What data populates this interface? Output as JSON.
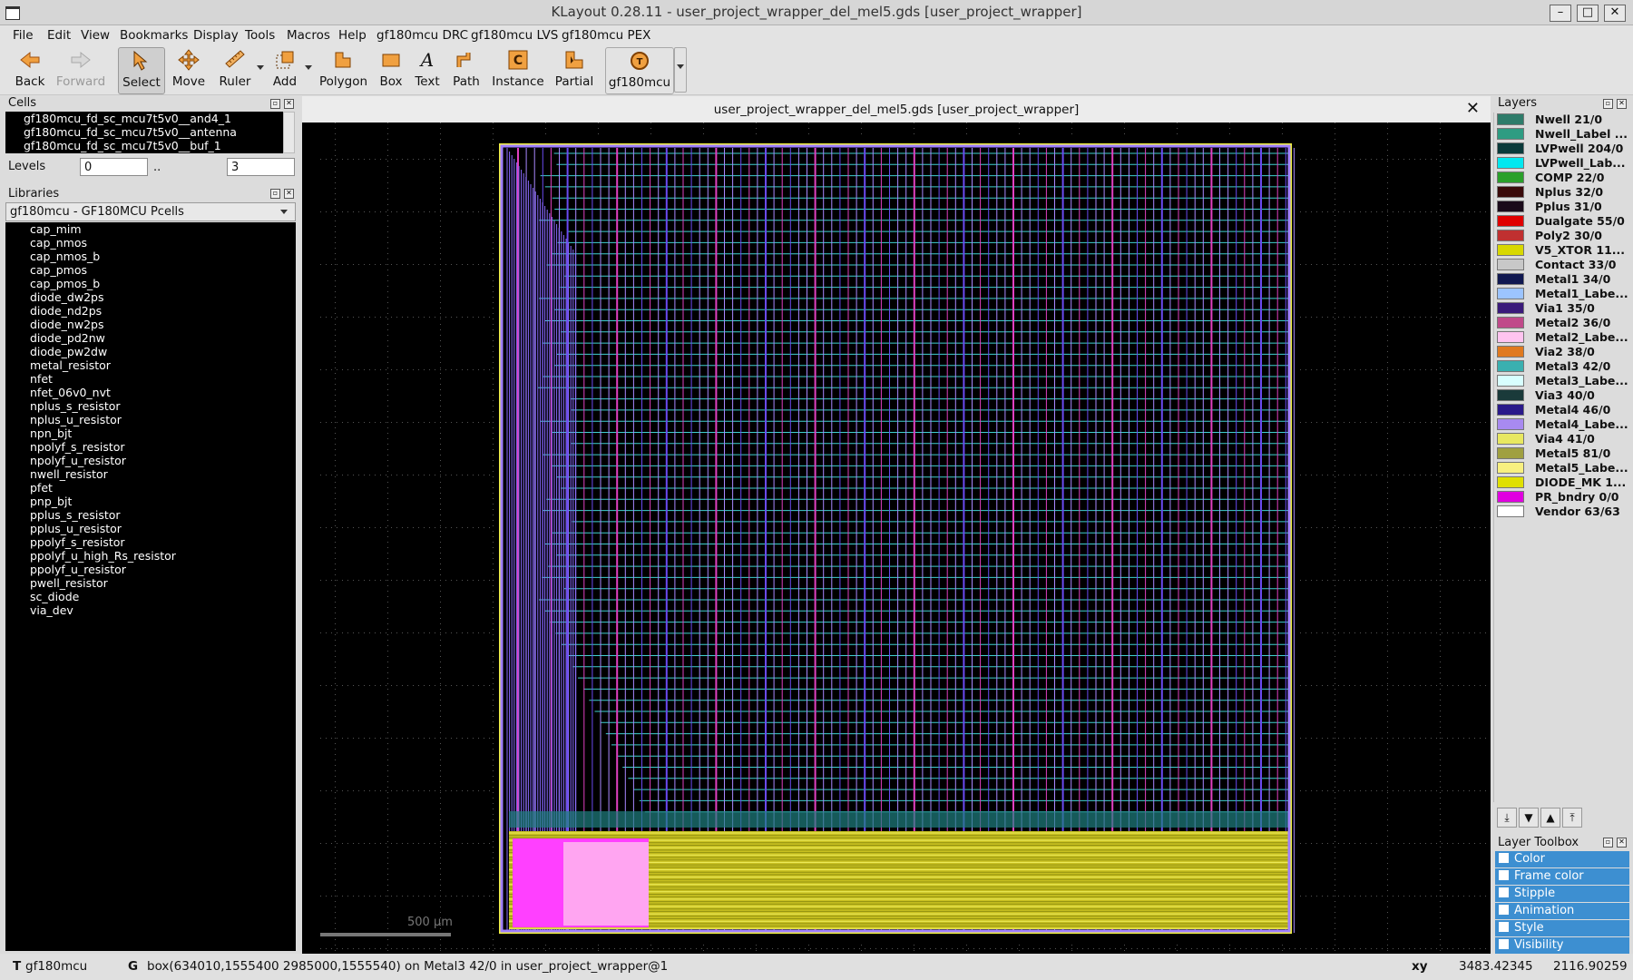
{
  "window": {
    "title": "KLayout 0.28.11 - user_project_wrapper_del_mel5.gds [user_project_wrapper]"
  },
  "menu": [
    "File",
    "Edit",
    "View",
    "Bookmarks",
    "Display",
    "Tools",
    "Macros",
    "Help",
    "gf180mcu DRC",
    "gf180mcu LVS",
    "gf180mcu PEX"
  ],
  "toolbar": {
    "back": "Back",
    "forward": "Forward",
    "select": "Select",
    "move": "Move",
    "ruler": "Ruler",
    "add": "Add",
    "polygon": "Polygon",
    "box": "Box",
    "text": "Text",
    "path": "Path",
    "instance": "Instance",
    "partial": "Partial",
    "tech": "gf180mcu"
  },
  "cells": {
    "title": "Cells",
    "items": [
      "gf180mcu_fd_sc_mcu7t5v0__and4_1",
      "gf180mcu_fd_sc_mcu7t5v0__antenna",
      "gf180mcu_fd_sc_mcu7t5v0__buf_1"
    ]
  },
  "levels": {
    "label": "Levels",
    "from": "0",
    "sep": "..",
    "to": "3"
  },
  "libraries": {
    "title": "Libraries",
    "selected": "gf180mcu - GF180MCU Pcells",
    "items": [
      "cap_mim",
      "cap_nmos",
      "cap_nmos_b",
      "cap_pmos",
      "cap_pmos_b",
      "diode_dw2ps",
      "diode_nd2ps",
      "diode_nw2ps",
      "diode_pd2nw",
      "diode_pw2dw",
      "metal_resistor",
      "nfet",
      "nfet_06v0_nvt",
      "nplus_s_resistor",
      "nplus_u_resistor",
      "npn_bjt",
      "npolyf_s_resistor",
      "npolyf_u_resistor",
      "nwell_resistor",
      "pfet",
      "pnp_bjt",
      "pplus_s_resistor",
      "pplus_u_resistor",
      "ppolyf_s_resistor",
      "ppolyf_u_high_Rs_resistor",
      "ppolyf_u_resistor",
      "pwell_resistor",
      "sc_diode",
      "via_dev"
    ]
  },
  "view": {
    "title": "user_project_wrapper_del_mel5.gds [user_project_wrapper]",
    "scale": "500 µm"
  },
  "layers": {
    "title": "Layers",
    "items": [
      {
        "name": "Nwell 21/0",
        "color": "#2e7c6a"
      },
      {
        "name": "Nwell_Label ...",
        "color": "#2e9c82"
      },
      {
        "name": "LVPwell 204/0",
        "color": "#0a3a3a"
      },
      {
        "name": "LVPwell_Lab...",
        "color": "#00e8f0"
      },
      {
        "name": "COMP 22/0",
        "color": "#2aa02a"
      },
      {
        "name": "Nplus 32/0",
        "color": "#3a0a0a"
      },
      {
        "name": "Pplus 31/0",
        "color": "#1a0a1a"
      },
      {
        "name": "Dualgate 55/0",
        "color": "#e00000"
      },
      {
        "name": "Poly2 30/0",
        "color": "#c03030"
      },
      {
        "name": "V5_XTOR 11...",
        "color": "#d8d800"
      },
      {
        "name": "Contact 33/0",
        "color": "#c8c8c8"
      },
      {
        "name": "Metal1 34/0",
        "color": "#101850"
      },
      {
        "name": "Metal1_Labe...",
        "color": "#9cc4ff"
      },
      {
        "name": "Via1 35/0",
        "color": "#3a1a7a"
      },
      {
        "name": "Metal2 36/0",
        "color": "#c04a8a"
      },
      {
        "name": "Metal2_Labe...",
        "color": "#ffc4f0"
      },
      {
        "name": "Via2 38/0",
        "color": "#e07a20"
      },
      {
        "name": "Metal3 42/0",
        "color": "#3ab0b0"
      },
      {
        "name": "Metal3_Labe...",
        "color": "#d8ffff"
      },
      {
        "name": "Via3 40/0",
        "color": "#1a3a3a"
      },
      {
        "name": "Metal4 46/0",
        "color": "#2a1a8a"
      },
      {
        "name": "Metal4_Labe...",
        "color": "#a88af0"
      },
      {
        "name": "Via4 41/0",
        "color": "#e8e860"
      },
      {
        "name": "Metal5 81/0",
        "color": "#a0a040"
      },
      {
        "name": "Metal5_Labe...",
        "color": "#f8f080"
      },
      {
        "name": "DIODE_MK 1...",
        "color": "#e0e000"
      },
      {
        "name": "PR_bndry 0/0",
        "color": "#e000e0"
      },
      {
        "name": "Vendor 63/63",
        "color": "#ffffff"
      }
    ]
  },
  "toolbox": {
    "title": "Layer Toolbox",
    "items": [
      "Color",
      "Frame color",
      "Stipple",
      "Animation",
      "Style",
      "Visibility"
    ]
  },
  "status": {
    "mode_key": "T",
    "mode": "gf180mcu",
    "info_key": "G",
    "info": "box(634010,1555400 2985000,1555540) on Metal3 42/0 in user_project_wrapper@1",
    "coord_key": "xy",
    "x": "3483.42345",
    "y": "2116.90259"
  }
}
